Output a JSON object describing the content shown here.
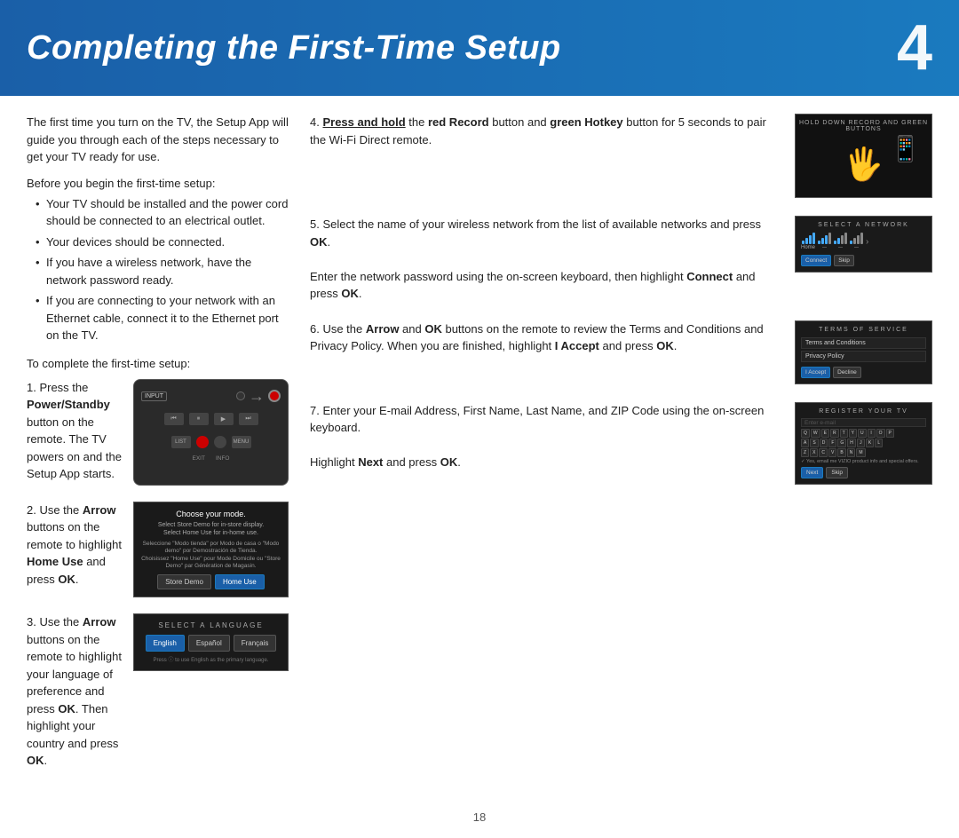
{
  "header": {
    "title": "Completing the First-Time Setup",
    "number": "4"
  },
  "intro": {
    "paragraph": "The first time you turn on the TV, the Setup App will guide you through each of the steps necessary to get your TV ready for use.",
    "before_title": "Before you begin the first-time setup:",
    "bullets": [
      "Your TV should be installed and the power cord should be connected to an electrical outlet.",
      "Your devices should be connected.",
      "If you have a wireless network, have the network password ready.",
      "If you are connecting to your network with an Ethernet cable, connect it to the Ethernet port on the TV."
    ],
    "complete_title": "To complete the first-time setup:"
  },
  "steps_left": [
    {
      "number": "1.",
      "text_parts": [
        {
          "text": "Press the ",
          "bold": false
        },
        {
          "text": "Power/Standby",
          "bold": true
        },
        {
          "text": " button on the remote. The TV powers on and the Setup App starts.",
          "bold": false
        }
      ],
      "screen": "remote"
    },
    {
      "number": "2.",
      "text_parts": [
        {
          "text": "Use the ",
          "bold": false
        },
        {
          "text": "Arrow",
          "bold": true
        },
        {
          "text": " buttons on the remote to highlight ",
          "bold": false
        },
        {
          "text": "Home Use",
          "bold": true
        },
        {
          "text": " and press ",
          "bold": false
        },
        {
          "text": "OK",
          "bold": true
        },
        {
          "text": ".",
          "bold": false
        }
      ],
      "screen": "choose_mode"
    },
    {
      "number": "3.",
      "text_parts": [
        {
          "text": "Use the ",
          "bold": false
        },
        {
          "text": "Arrow",
          "bold": true
        },
        {
          "text": " buttons on the remote to highlight your language of preference and press ",
          "bold": false
        },
        {
          "text": "OK",
          "bold": true
        },
        {
          "text": ". Then highlight your country and press ",
          "bold": false
        },
        {
          "text": "OK",
          "bold": true
        },
        {
          "text": ".",
          "bold": false
        }
      ],
      "screen": "language"
    }
  ],
  "steps_right": [
    {
      "number": "4.",
      "text_parts": [
        {
          "text": "Press and hold",
          "bold": true,
          "underline": true
        },
        {
          "text": " the ",
          "bold": false
        },
        {
          "text": "red Record",
          "bold": true
        },
        {
          "text": " button and ",
          "bold": false
        },
        {
          "text": "green Hotkey",
          "bold": true
        },
        {
          "text": " button for 5 seconds to pair the Wi-Fi Direct remote.",
          "bold": false
        }
      ],
      "screen": "hold_buttons"
    },
    {
      "number": "5.",
      "text_parts": [
        {
          "text": "Select the name of your wireless network from the list of available networks and press ",
          "bold": false
        },
        {
          "text": "OK",
          "bold": true
        },
        {
          "text": ".",
          "bold": false
        }
      ],
      "text2_parts": [
        {
          "text": "Enter the network password using the on-screen keyboard, then highlight ",
          "bold": false
        },
        {
          "text": "Connect",
          "bold": true
        },
        {
          "text": " and press ",
          "bold": false
        },
        {
          "text": "OK",
          "bold": true
        },
        {
          "text": ".",
          "bold": false
        }
      ],
      "screen": "network"
    },
    {
      "number": "6.",
      "text_parts": [
        {
          "text": "Use the ",
          "bold": false
        },
        {
          "text": "Arrow",
          "bold": true
        },
        {
          "text": " and ",
          "bold": false
        },
        {
          "text": "OK",
          "bold": true
        },
        {
          "text": " buttons on the remote to review the Terms and Conditions and Privacy Policy. When you are finished, highlight ",
          "bold": false
        },
        {
          "text": "I Accept",
          "bold": true
        },
        {
          "text": " and press ",
          "bold": false
        },
        {
          "text": "OK",
          "bold": true
        },
        {
          "text": ".",
          "bold": false
        }
      ],
      "screen": "terms"
    },
    {
      "number": "7.",
      "text_parts": [
        {
          "text": "Enter your E-mail Address, First Name, Last Name, and ZIP Code using the on-screen keyboard.",
          "bold": false
        }
      ],
      "text2_parts": [
        {
          "text": "Highlight ",
          "bold": false
        },
        {
          "text": "Next",
          "bold": true
        },
        {
          "text": " and press ",
          "bold": false
        },
        {
          "text": "OK",
          "bold": true
        },
        {
          "text": ".",
          "bold": false
        }
      ],
      "screen": "register"
    }
  ],
  "page_number": "18",
  "screens": {
    "choose_mode_title": "Choose your mode.",
    "choose_mode_sub": "Select Store Demo for in-store display.\nSelect Home Use for in-home use.",
    "choose_mode_text": "Seleccione \"Modo tienda\" por Modo de casa o \"Modo demo\" por Demostración de Tienda.\nChoisissez \"Home Use\" pour Mode Domicile ou \"Store Demo\" par Génération de Magasin.",
    "store_demo_btn": "Store Demo",
    "home_use_btn": "Home Use",
    "lang_title": "SELECT A LANGUAGE",
    "lang_english": "English",
    "lang_espanol": "Español",
    "lang_francais": "Français",
    "lang_note": "Press ⓘ to use English as the primary language.",
    "hold_label": "HOLD DOWN RECORD AND GREEN BUTTONS",
    "network_title": "SELECT A NETWORK",
    "terms_title": "TERMS OF SERVICE",
    "terms_item1": "Terms and Conditions",
    "terms_item2": "Privacy Policy",
    "terms_accept": "I Accept",
    "terms_decline": "Decline",
    "register_title": "REGISTER YOUR TV"
  }
}
